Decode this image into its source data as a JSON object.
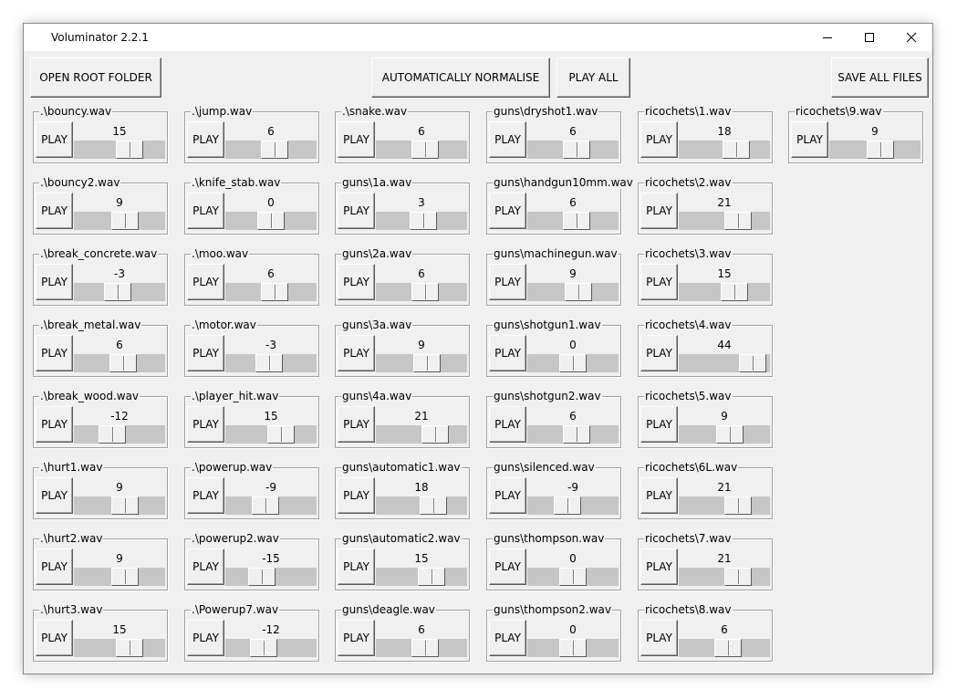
{
  "window": {
    "title": "Voluminator 2.2.1"
  },
  "toolbar": {
    "open_root_folder": "OPEN ROOT FOLDER",
    "auto_normalise": "AUTOMATICALLY NORMALISE",
    "play_all": "PLAY ALL",
    "save_all": "SAVE ALL FILES"
  },
  "slider_range": [
    -50,
    50
  ],
  "play_label": "PLAY",
  "columns": [
    [
      {
        "file": ".\\bouncy.wav",
        "volume": "15"
      },
      {
        "file": ".\\bouncy2.wav",
        "volume": "9"
      },
      {
        "file": ".\\break_concrete.wav",
        "volume": "-3"
      },
      {
        "file": ".\\break_metal.wav",
        "volume": "6"
      },
      {
        "file": ".\\break_wood.wav",
        "volume": "-12"
      },
      {
        "file": ".\\hurt1.wav",
        "volume": "9"
      },
      {
        "file": ".\\hurt2.wav",
        "volume": "9"
      },
      {
        "file": ".\\hurt3.wav",
        "volume": "15"
      }
    ],
    [
      {
        "file": ".\\jump.wav",
        "volume": "6"
      },
      {
        "file": ".\\knife_stab.wav",
        "volume": "0"
      },
      {
        "file": ".\\moo.wav",
        "volume": "6"
      },
      {
        "file": ".\\motor.wav",
        "volume": "-3"
      },
      {
        "file": ".\\player_hit.wav",
        "volume": "15"
      },
      {
        "file": ".\\powerup.wav",
        "volume": "-9"
      },
      {
        "file": ".\\powerup2.wav",
        "volume": "-15"
      },
      {
        "file": ".\\Powerup7.wav",
        "volume": "-12"
      }
    ],
    [
      {
        "file": ".\\snake.wav",
        "volume": "6"
      },
      {
        "file": "guns\\1a.wav",
        "volume": "3"
      },
      {
        "file": "guns\\2a.wav",
        "volume": "6"
      },
      {
        "file": "guns\\3a.wav",
        "volume": "9"
      },
      {
        "file": "guns\\4a.wav",
        "volume": "21"
      },
      {
        "file": "guns\\automatic1.wav",
        "volume": "18"
      },
      {
        "file": "guns\\automatic2.wav",
        "volume": "15"
      },
      {
        "file": "guns\\deagle.wav",
        "volume": "6"
      }
    ],
    [
      {
        "file": "guns\\dryshot1.wav",
        "volume": "6"
      },
      {
        "file": "guns\\handgun10mm.wav",
        "volume": "6"
      },
      {
        "file": "guns\\machinegun.wav",
        "volume": "9"
      },
      {
        "file": "guns\\shotgun1.wav",
        "volume": "0"
      },
      {
        "file": "guns\\shotgun2.wav",
        "volume": "6"
      },
      {
        "file": "guns\\silenced.wav",
        "volume": "-9"
      },
      {
        "file": "guns\\thompson.wav",
        "volume": "0"
      },
      {
        "file": "guns\\thompson2.wav",
        "volume": "0"
      }
    ],
    [
      {
        "file": "ricochets\\1.wav",
        "volume": "18"
      },
      {
        "file": "ricochets\\2.wav",
        "volume": "21"
      },
      {
        "file": "ricochets\\3.wav",
        "volume": "15"
      },
      {
        "file": "ricochets\\4.wav",
        "volume": "44"
      },
      {
        "file": "ricochets\\5.wav",
        "volume": "9"
      },
      {
        "file": "ricochets\\6L.wav",
        "volume": "21"
      },
      {
        "file": "ricochets\\7.wav",
        "volume": "21"
      },
      {
        "file": "ricochets\\8.wav",
        "volume": "6"
      }
    ],
    [
      {
        "file": "ricochets\\9.wav",
        "volume": "9"
      }
    ]
  ]
}
